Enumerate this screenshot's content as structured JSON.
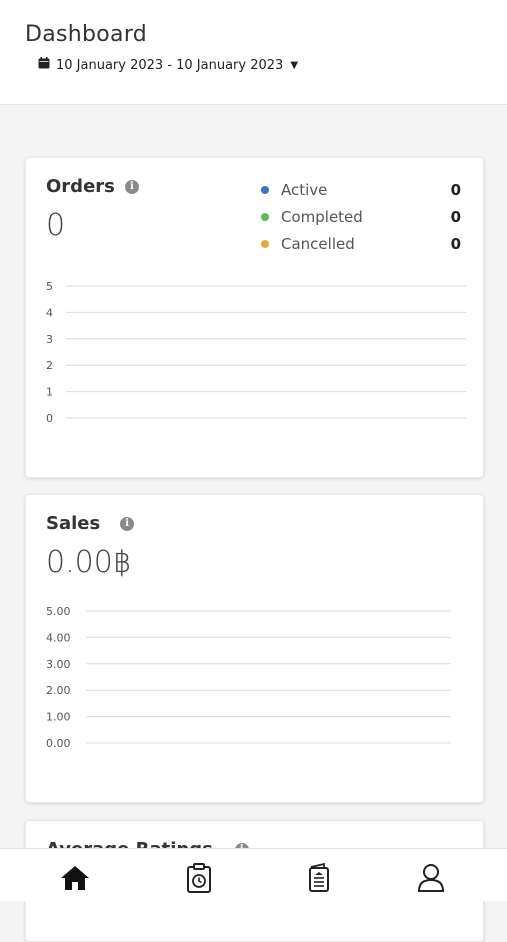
{
  "header": {
    "title": "Dashboard",
    "date_range": "10 January 2023 - 10 January 2023",
    "calendar_icon": "calendar-icon",
    "caret_icon": "caret-down-icon"
  },
  "orders": {
    "title": "Orders",
    "value": "0",
    "legend": [
      {
        "label": "Active",
        "count": "0",
        "color": "#3f6fd1"
      },
      {
        "label": "Completed",
        "count": "0",
        "color": "#5dbb63"
      },
      {
        "label": "Cancelled",
        "count": "0",
        "color": "#e5a93b"
      }
    ]
  },
  "sales": {
    "title": "Sales",
    "value": "0.00฿"
  },
  "ratings": {
    "title": "Average Ratings"
  },
  "nav": {
    "items": [
      {
        "icon": "home-icon",
        "active": true
      },
      {
        "icon": "clipboard-clock-icon",
        "active": false
      },
      {
        "icon": "menu-document-icon",
        "active": false
      },
      {
        "icon": "user-icon",
        "active": false
      }
    ]
  },
  "chart_data": [
    {
      "type": "bar",
      "categories": [],
      "values": [],
      "title": "Orders",
      "ylim": [
        0,
        5
      ],
      "yticks": [
        "5",
        "4",
        "3",
        "2",
        "1",
        "0"
      ],
      "grid": true
    },
    {
      "type": "bar",
      "categories": [],
      "values": [],
      "title": "Sales",
      "ylim": [
        0,
        5
      ],
      "yticks": [
        "5.00",
        "4.00",
        "3.00",
        "2.00",
        "1.00",
        "0.00"
      ],
      "grid": true
    }
  ]
}
